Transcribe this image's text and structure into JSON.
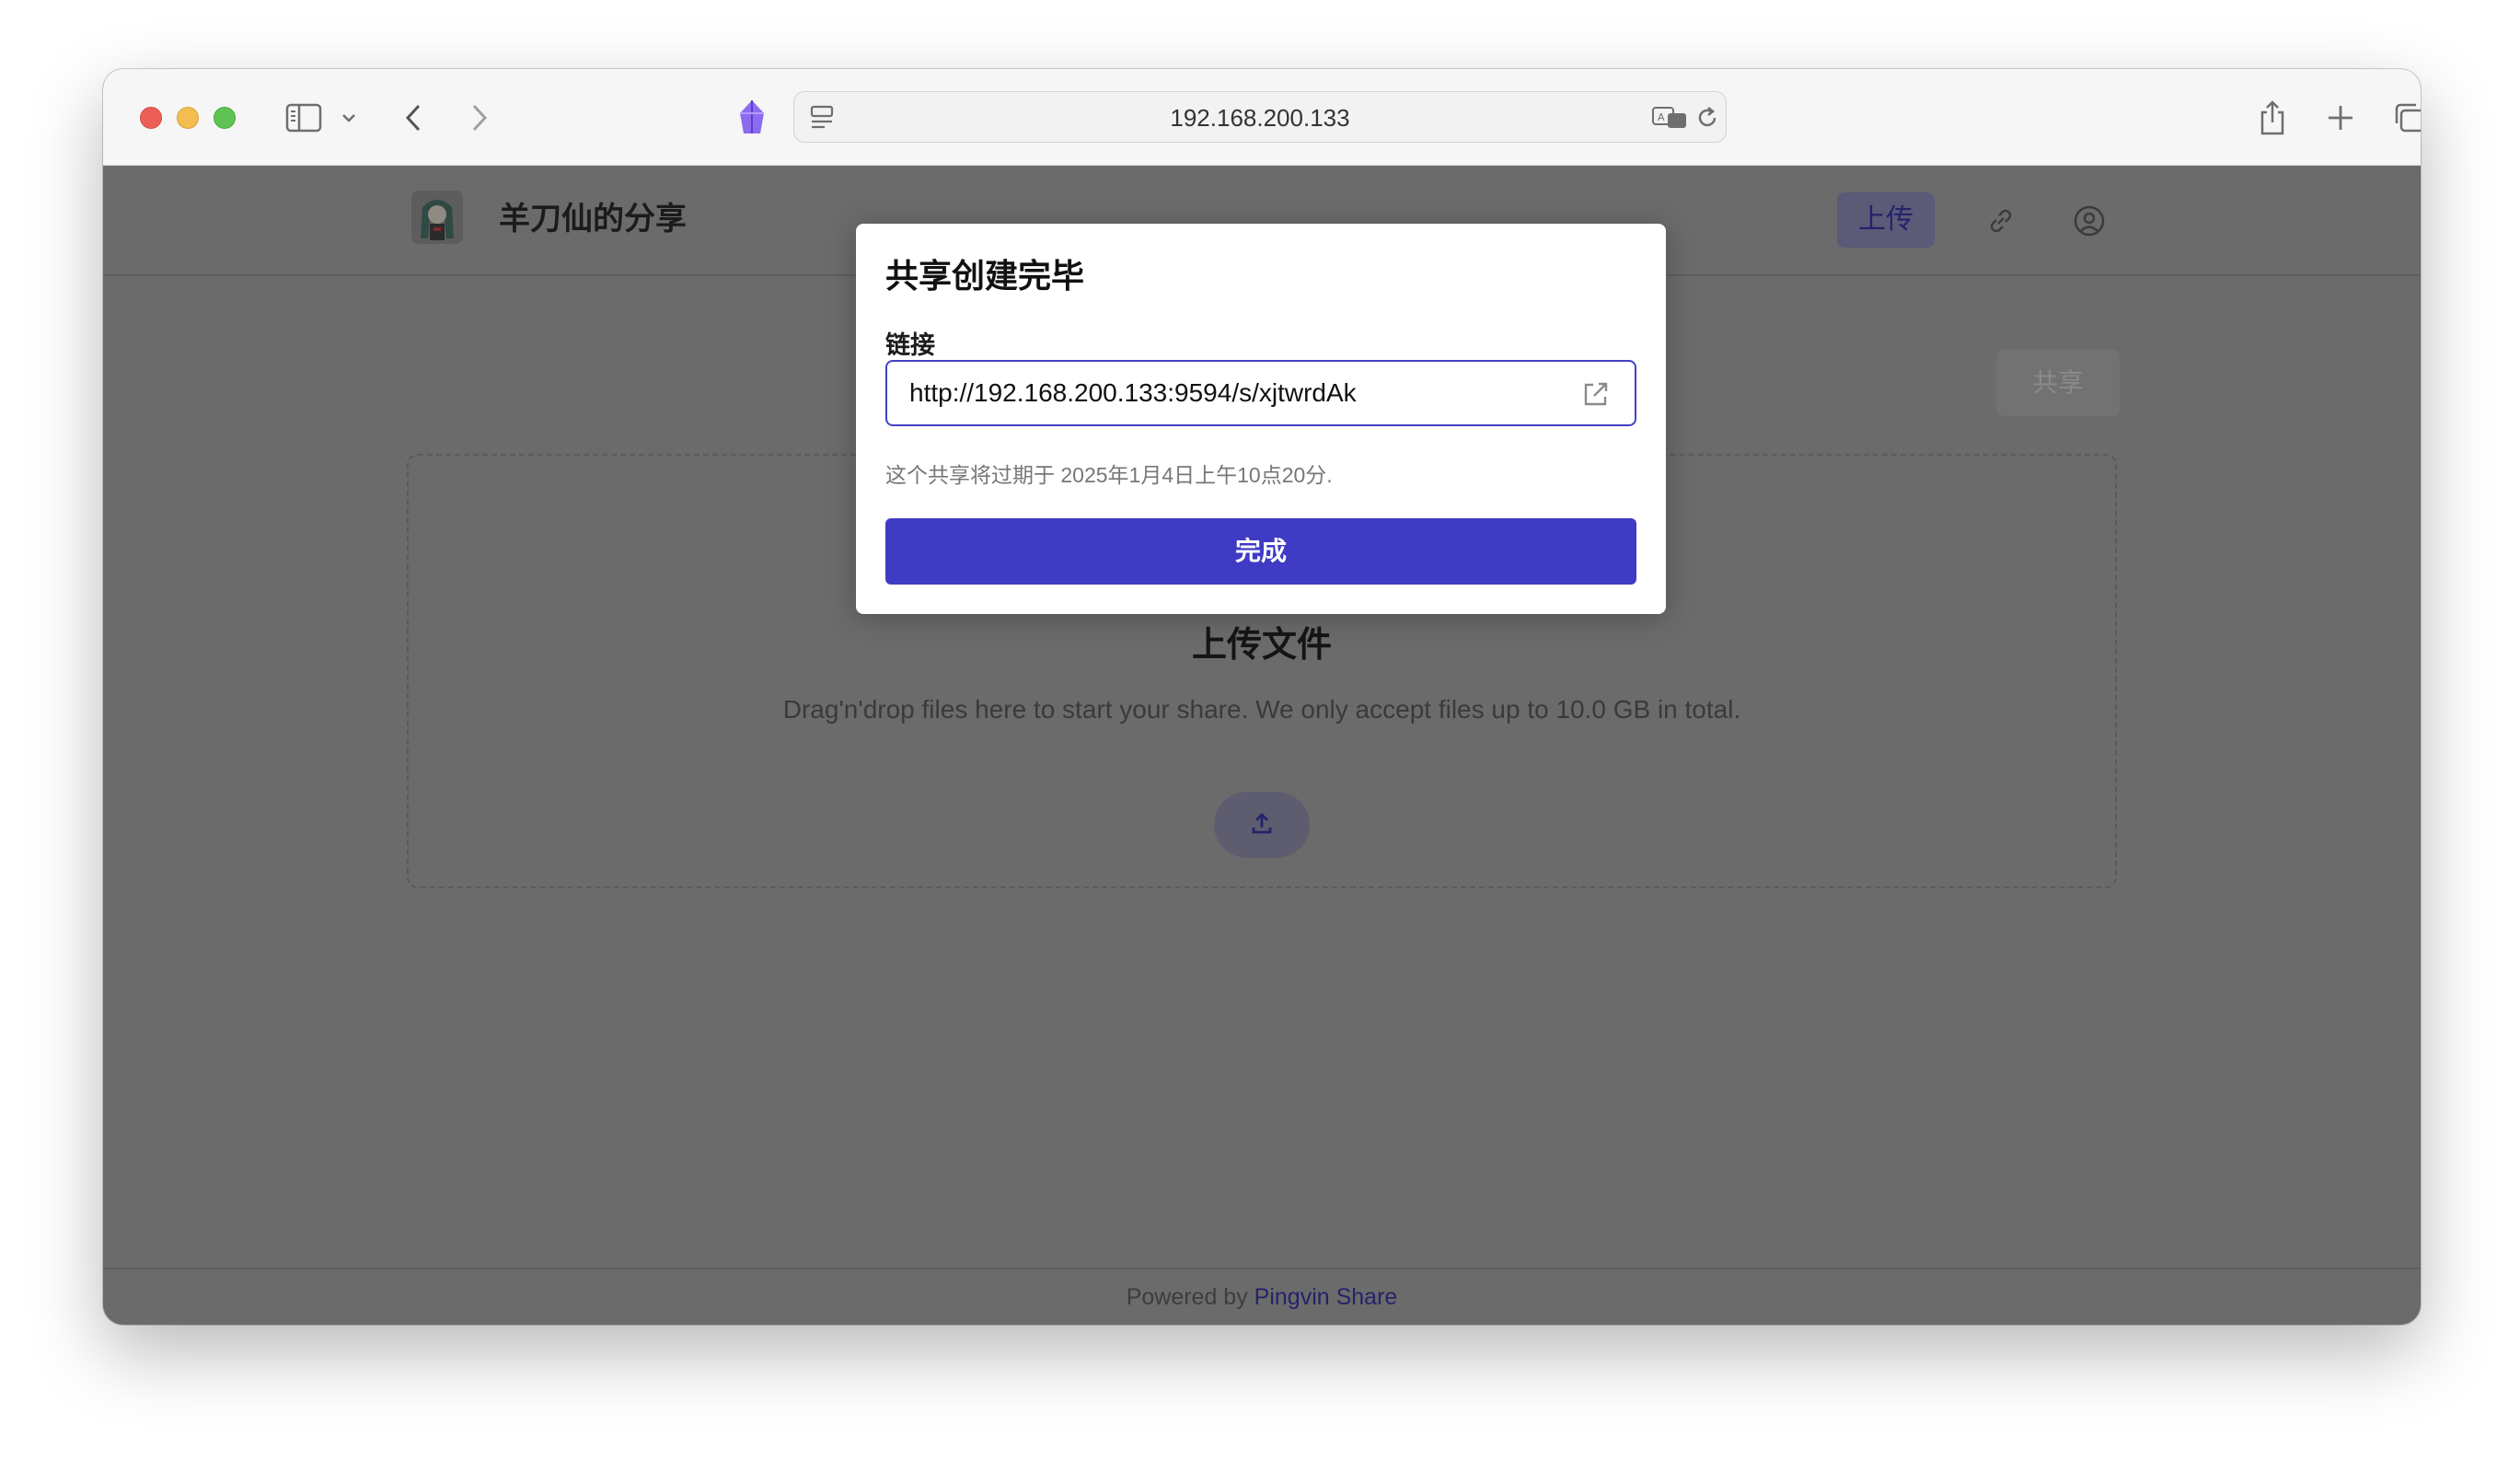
{
  "browser": {
    "address": "192.168.200.133",
    "icons": [
      "sidebar-icon",
      "chevron-down-icon",
      "back-icon",
      "forward-icon",
      "extension-icon",
      "site-settings-icon",
      "translate-icon",
      "reload-icon",
      "share-icon",
      "new-tab-icon",
      "tab-overview-icon"
    ]
  },
  "site": {
    "title": "羊刀仙的分享",
    "upload_label": "上传",
    "share_label": "共享"
  },
  "dropzone": {
    "title": "上传文件",
    "description": "Drag'n'drop files here to start your share. We only accept files up to 10.0 GB in total."
  },
  "footer": {
    "prefix": "Powered by ",
    "link": "Pingvin Share"
  },
  "modal": {
    "title": "共享创建完毕",
    "link_label": "链接",
    "link_value": "http://192.168.200.133:9594/s/xjtwrdAk",
    "expire_text": "这个共享将过期于 2025年1月4日上午10点20分.",
    "done_label": "完成"
  },
  "colors": {
    "accent": "#403bc4",
    "overlay": "#6b6b6b"
  }
}
